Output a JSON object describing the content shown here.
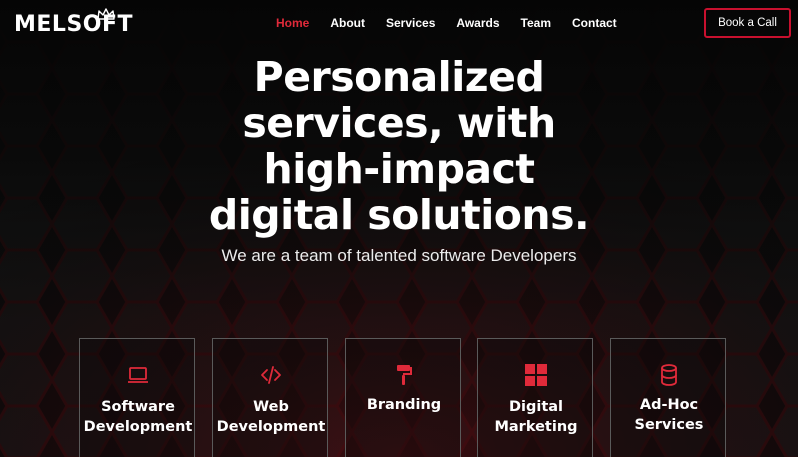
{
  "brand": {
    "name": "MELSOFT",
    "accent": "#c8102e"
  },
  "nav": {
    "items": [
      {
        "label": "Home",
        "active": true
      },
      {
        "label": "About"
      },
      {
        "label": "Services"
      },
      {
        "label": "Awards"
      },
      {
        "label": "Team"
      },
      {
        "label": "Contact"
      }
    ],
    "cta": "Book a Call"
  },
  "hero": {
    "lines": [
      "Personalized",
      "services, with",
      "high-impact",
      "digital solutions."
    ],
    "subtitle": "We are a team of talented software Developers"
  },
  "services": [
    {
      "label": "Software\nDevelopment",
      "icon": "laptop-icon"
    },
    {
      "label": "Web\nDevelopment",
      "icon": "code-icon"
    },
    {
      "label": "Branding",
      "icon": "paint-roller-icon"
    },
    {
      "label": "Digital\nMarketing",
      "icon": "grid-icon"
    },
    {
      "label": "Ad-Hoc\nServices",
      "icon": "database-icon"
    }
  ]
}
